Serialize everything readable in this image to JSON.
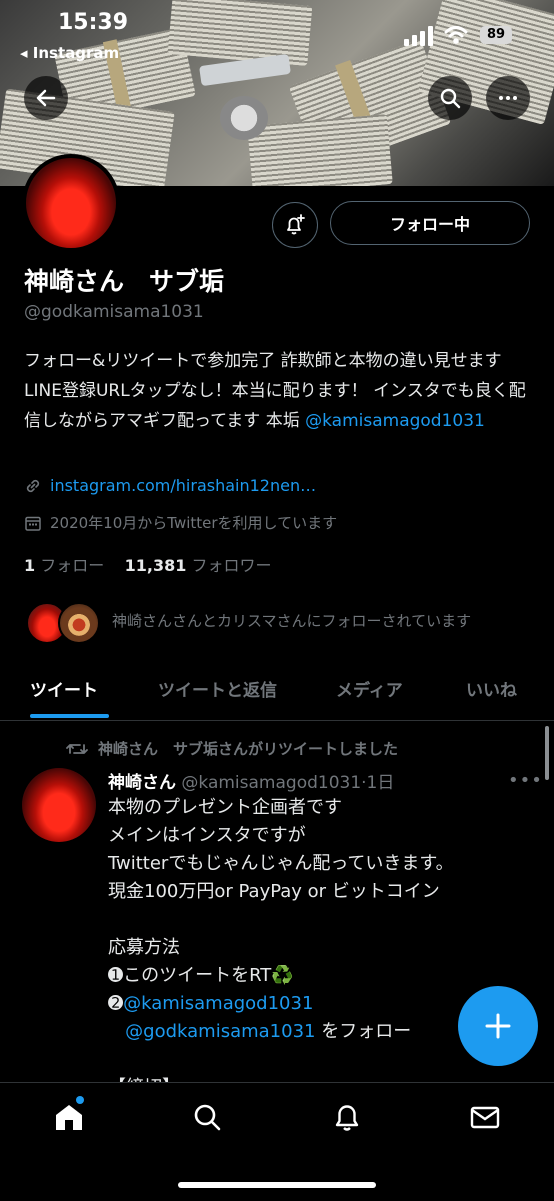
{
  "status_bar": {
    "time": "15:39",
    "back_app": "◂ Instagram",
    "battery": "89"
  },
  "header": {
    "back_icon": "arrow-left-icon",
    "search_icon": "search-icon",
    "more_icon": "more-horizontal-icon"
  },
  "profile": {
    "notification_icon": "bell-plus-icon",
    "follow_button": "フォロー中",
    "display_name": "神崎さん　サブ垢",
    "handle": "@godkamisama1031",
    "bio_text": "フォロー&リツイートで参加完了 詐欺師と本物の違い見せます LINE登録URLタップなし！本当に配ります！ インスタでも良く配信しながらアマギフ配ってます 本垢",
    "bio_mention": "@kamisamagod1031",
    "website": "instagram.com/hirashain12nen…",
    "joined": "2020年10月からTwitterを利用しています",
    "following_count": "1",
    "following_label": "フォロー",
    "followers_count": "11,381",
    "followers_label": "フォロワー",
    "followed_by": "神崎さんさんとカリスマさんにフォローされています"
  },
  "tabs": [
    {
      "label": "ツイート"
    },
    {
      "label": "ツイートと返信"
    },
    {
      "label": "メディア"
    },
    {
      "label": "いいね"
    }
  ],
  "tweet": {
    "retweet_label": "神崎さん　サブ垢さんがリツイートしました",
    "author_name": "神崎さん",
    "author_handle": "@kamisamagod1031·1日",
    "more": "•••",
    "body_lines_1": "本物のプレゼント企画者です\nメインはインスタですが\nTwitterでもじゃんじゃん配っていきます。\n現金100万円or PayPay or ビットコイン\n\n応募方法\n➊このツイートをRT♻️",
    "step2_prefix": "➋",
    "step2_mention": "@kamisamagod1031",
    "step2b_mention": "@godkamisama1031",
    "step2b_suffix": " をフォロー",
    "next_line": "【締切】"
  },
  "fab": {
    "icon": "plus-icon"
  },
  "bottom_nav": [
    {
      "icon": "home-icon"
    },
    {
      "icon": "search-icon"
    },
    {
      "icon": "bell-icon"
    },
    {
      "icon": "mail-icon"
    }
  ],
  "colors": {
    "accent": "#1d9bf0",
    "background": "#000000",
    "muted": "#71767b"
  }
}
